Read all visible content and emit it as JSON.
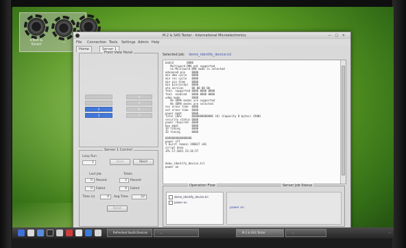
{
  "desktop": {
    "icons": [
      {
        "label": "eTest & Smart",
        "icon": "gear-icon"
      },
      {
        "label": "...",
        "icon": "gear-icon"
      },
      {
        "label": "",
        "icon": "gear-icon"
      }
    ]
  },
  "window": {
    "title": "M.2 & SAS Tester - International Microelectronics",
    "controls": "— □ ✕"
  },
  "menu": [
    "File",
    "Connection",
    "Tools",
    "Settings",
    "Admin",
    "Help"
  ],
  "tabs": [
    {
      "label": "Home"
    },
    {
      "label": "Server 1"
    }
  ],
  "front_view": {
    "title": "Front View Panel",
    "slots_left": [
      "",
      "",
      "2",
      "3"
    ],
    "slots_right": [
      "4",
      "5",
      "6",
      "7"
    ]
  },
  "server_control": {
    "title": "Server 1 Control",
    "loop_label": "Loop Run",
    "loop_value": "1",
    "start_label": "Start",
    "abort_label": "Abort",
    "last_job_label": "Last Job",
    "totals_label": "Totals",
    "passed_label": "Passed",
    "failed_label": "Failed",
    "last_passed": "0",
    "last_failed": "0",
    "total_passed": "2",
    "total_failed": "4",
    "time_label": "Time (s)",
    "time_value": "4",
    "avg_label": "Avg Time",
    "avg_value": "22",
    "reset_label": "Reset"
  },
  "job": {
    "label": "Selected Job:",
    "name": "demo_identify_device.tcl"
  },
  "log": [
    "badid        0000",
    "   Multiword DMA not supported",
    "   no Multiword DMA mode is selected",
    "advanced pio    0000",
    "min dma cycle   0000",
    "min rec cycle   0000",
    "min pio time    0000",
    "min pio(iordy)  0000",
    "ata version     00 00 00 00",
    "feat. supported 0000 0000 0000",
    "feat. enabled   0000 0000 0000",
    "udma mode       0000",
    "   No UDMA modes are supported",
    "   No UDMA modes are selected",
    "sec erase time  0000",
    "ext erase time  0000",
    "power mgmt      0000",
    "Total LBAs      0000000000000 (0) (Capacity 0 bytes) (RAW)",
    "security status 0000",
    "power required  0000",
    "key mgmt        0000",
    "ID timing       0000",
    "ID timing       0000",
    "",
    "0000000000000000",
    "power off",
    "5 burst remain 190017 s01",
    "script done",
    "JPL-17-2015 23:16:57",
    "",
    "",
    "",
    "demo_identify_device.tcl",
    "power on"
  ],
  "flow": {
    "title": "Operation Flow",
    "items": [
      "demo_identify_device.tcl",
      "power on"
    ]
  },
  "server_status": {
    "title": "Server Job Status",
    "text": "power on"
  },
  "taskbar": {
    "tasks": [
      {
        "label": "Refreshed South Devices"
      },
      {
        "label": "..."
      },
      {
        "label": "M.2 & SAS Tester"
      },
      {
        "label": "..."
      }
    ],
    "clock": "..."
  }
}
